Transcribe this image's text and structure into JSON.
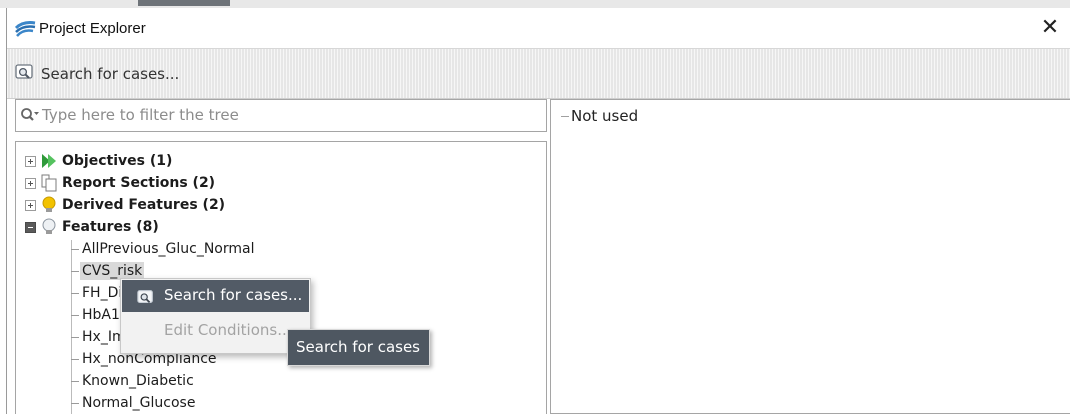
{
  "window": {
    "title": "Project Explorer",
    "close_glyph": "✕",
    "app_icon": "project-explorer-logo-icon"
  },
  "toolbar": {
    "search_button_label": "Search for cases...",
    "search_button_icon": "search-cases-icon"
  },
  "filter": {
    "placeholder": "Type here to filter the tree",
    "icon": "search-dropdown-icon"
  },
  "tree": {
    "nodes": [
      {
        "label": "Objectives (1)",
        "icon": "objectives-flag-icon",
        "expanded": false
      },
      {
        "label": "Report Sections (2)",
        "icon": "report-sections-icon",
        "expanded": false
      },
      {
        "label": "Derived Features (2)",
        "icon": "derived-bulb-icon",
        "expanded": false
      },
      {
        "label": "Features (8)",
        "icon": "features-bulb-icon",
        "expanded": true
      }
    ],
    "features": [
      "AllPrevious_Gluc_Normal",
      "CVS_risk",
      "FH_Dia",
      "HbA1c_",
      "Hx_Imp",
      "Hx_nonCompliance",
      "Known_Diabetic",
      "Normal_Glucose"
    ],
    "selected": "CVS_risk"
  },
  "right_pane": {
    "item": "Not used"
  },
  "context_menu": {
    "search_label": "Search for cases...",
    "edit_label": "Edit Conditions..."
  },
  "tooltip": {
    "text": "Search for cases"
  },
  "colors": {
    "menu_highlight": "#525b66",
    "tooltip_bg": "#4e5761",
    "selection": "#d9d9d9",
    "bulb_yellow": "#f2c200",
    "flag_green": "#2f9a3a"
  }
}
